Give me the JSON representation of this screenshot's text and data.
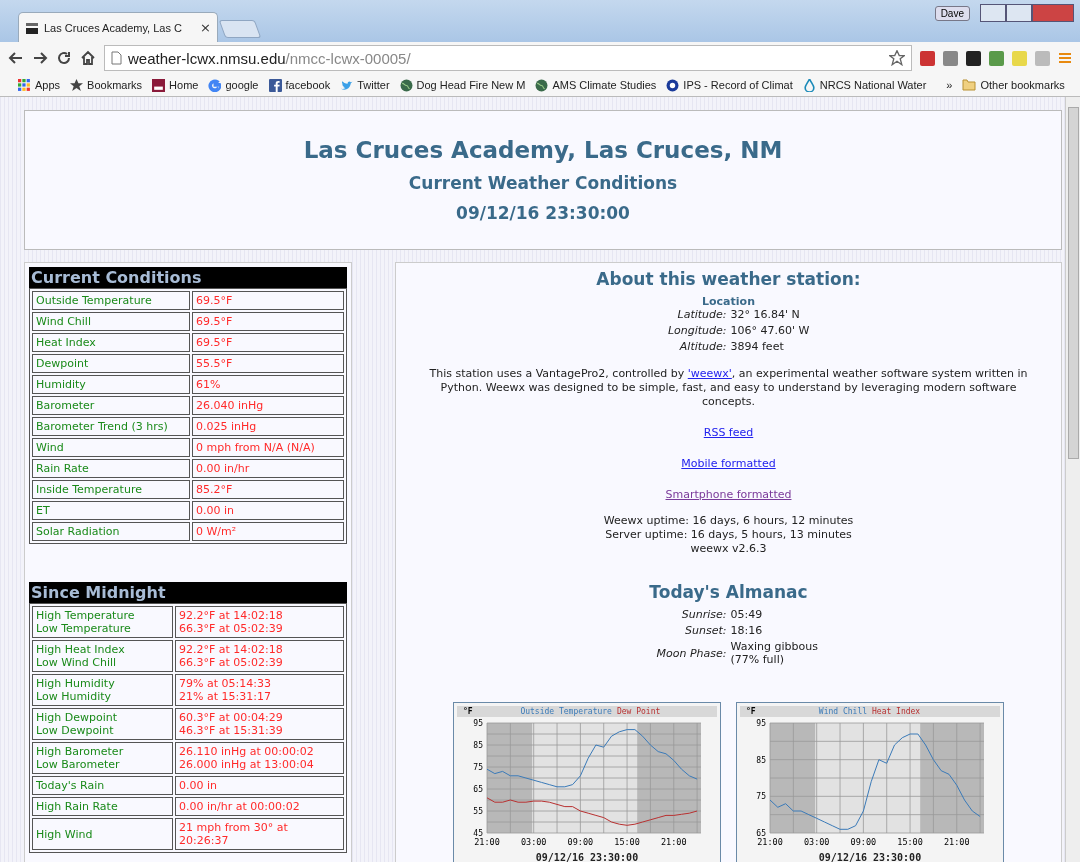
{
  "browser": {
    "tab": {
      "title": "Las Cruces Academy, Las C",
      "close": "×"
    },
    "profile": "Dave",
    "address": {
      "domain": "weather-lcwx.nmsu.edu",
      "path": "/nmcc-lcwx-00005/"
    },
    "bookmarks": [
      {
        "label": "Apps",
        "kind": "apps"
      },
      {
        "label": "Bookmarks",
        "kind": "star"
      },
      {
        "label": "Home",
        "kind": "badge"
      },
      {
        "label": "google",
        "kind": "google"
      },
      {
        "label": "facebook",
        "kind": "facebook"
      },
      {
        "label": "Twitter",
        "kind": "twitter"
      },
      {
        "label": "Dog Head Fire New M",
        "kind": "globe"
      },
      {
        "label": "AMS Climate Studies",
        "kind": "globe"
      },
      {
        "label": "IPS - Record of Climat",
        "kind": "seal"
      },
      {
        "label": "NRCS National Water",
        "kind": "drop"
      }
    ],
    "overflow": "»",
    "other_bookmarks": "Other bookmarks"
  },
  "header": {
    "station": "Las Cruces Academy, Las Cruces, NM",
    "subtitle": "Current Weather Conditions",
    "timestamp": "09/12/16 23:30:00"
  },
  "current_conditions": {
    "title": "Current Conditions",
    "rows": [
      {
        "label": "Outside Temperature",
        "value": "69.5°F"
      },
      {
        "label": "Wind Chill",
        "value": "69.5°F"
      },
      {
        "label": "Heat Index",
        "value": "69.5°F"
      },
      {
        "label": "Dewpoint",
        "value": "55.5°F"
      },
      {
        "label": "Humidity",
        "value": "61%"
      },
      {
        "label": "Barometer",
        "value": "26.040 inHg"
      },
      {
        "label": "Barometer Trend (3 hrs)",
        "value": "0.025 inHg"
      },
      {
        "label": "Wind",
        "value": "0 mph from N/A (N/A)"
      },
      {
        "label": "Rain Rate",
        "value": "0.00 in/hr"
      },
      {
        "label": "Inside Temperature",
        "value": "85.2°F"
      },
      {
        "label": "ET",
        "value": "0.00 in"
      },
      {
        "label": "Solar Radiation",
        "value": "0 W/m²"
      }
    ]
  },
  "since_midnight": {
    "title": "Since Midnight",
    "rows": [
      {
        "labels": [
          "High Temperature",
          "Low Temperature"
        ],
        "values": [
          "92.2°F at 14:02:18",
          "66.3°F at 05:02:39"
        ]
      },
      {
        "labels": [
          "High Heat Index",
          "Low Wind Chill"
        ],
        "values": [
          "92.2°F at 14:02:18",
          "66.3°F at 05:02:39"
        ]
      },
      {
        "labels": [
          "High Humidity",
          "Low Humidity"
        ],
        "values": [
          "79% at 05:14:33",
          "21% at 15:31:17"
        ]
      },
      {
        "labels": [
          "High Dewpoint",
          "Low Dewpoint"
        ],
        "values": [
          "60.3°F at 00:04:29",
          "46.3°F at 15:31:39"
        ]
      },
      {
        "labels": [
          "High Barometer",
          "Low Barometer"
        ],
        "values": [
          "26.110 inHg at 00:00:02",
          "26.000 inHg at 13:00:04"
        ]
      },
      {
        "labels": [
          "Today's Rain"
        ],
        "values": [
          "0.00 in"
        ]
      },
      {
        "labels": [
          "High Rain Rate"
        ],
        "values": [
          "0.00 in/hr at 00:00:02"
        ]
      },
      {
        "labels": [
          "High Wind"
        ],
        "values": [
          "21 mph from 30° at 20:26:37"
        ]
      }
    ]
  },
  "about": {
    "title": "About this weather station:",
    "location_heading": "Location",
    "location": [
      {
        "label": "Latitude:",
        "value": "32° 16.84' N"
      },
      {
        "label": "Longitude:",
        "value": "106° 47.60' W"
      },
      {
        "label": "Altitude:",
        "value": "3894 feet"
      }
    ],
    "description_before": "This station uses a VantagePro2, controlled by ",
    "description_link": "'weewx'",
    "description_after": ", an experimental weather software system written in Python. Weewx was designed to be simple, fast, and easy to understand by leveraging modern software concepts.",
    "links": [
      {
        "label": "RSS feed",
        "visited": false
      },
      {
        "label": "Mobile formatted",
        "visited": false
      },
      {
        "label": "Smartphone formatted",
        "visited": true
      }
    ],
    "uptime": [
      "Weewx uptime: 16 days, 6 hours, 12 minutes",
      "Server uptime: 16 days, 5 hours, 13 minutes",
      "weewx v2.6.3"
    ]
  },
  "almanac": {
    "title": "Today's Almanac",
    "rows": [
      {
        "label": "Sunrise:",
        "value": "05:49"
      },
      {
        "label": "Sunset:",
        "value": "18:16"
      },
      {
        "label": "Moon Phase:",
        "value": "Waxing gibbous\n(77% full)"
      }
    ]
  },
  "charts": [
    {
      "timestamp": "09/12/16 23:30:00",
      "chart_data": {
        "type": "line",
        "grid": true,
        "ylabel": "°F",
        "ylim": [
          45,
          95
        ],
        "yticks": [
          45,
          55,
          65,
          75,
          85,
          95
        ],
        "categories": [
          "21:00",
          null,
          null,
          null,
          null,
          null,
          "03:00",
          null,
          null,
          null,
          null,
          null,
          "09:00",
          null,
          null,
          null,
          null,
          null,
          "15:00",
          null,
          null,
          null,
          null,
          null,
          "21:00",
          null,
          null,
          null
        ],
        "series": [
          {
            "name": "Outside Temperature",
            "color": "#3a7ab8",
            "values": [
              74,
              72,
              73,
              71,
              71,
              70,
              69,
              68,
              67,
              66,
              66,
              67,
              71,
              79,
              85,
              84,
              89,
              91,
              92,
              92,
              89,
              85,
              82,
              81,
              78,
              74,
              71,
              69.5
            ]
          },
          {
            "name": "Dew Point",
            "color": "#b83030",
            "values": [
              61,
              59,
              59,
              60,
              59,
              59,
              59.5,
              59.5,
              59,
              58,
              57,
              57,
              55,
              54,
              53,
              52,
              50,
              49,
              48.5,
              49,
              50,
              51,
              52,
              53,
              53,
              53.5,
              54,
              55
            ]
          }
        ]
      }
    },
    {
      "timestamp": "09/12/16 23:30:00",
      "chart_data": {
        "type": "line",
        "grid": true,
        "ylabel": "°F",
        "ylim": [
          65,
          95
        ],
        "yticks": [
          65,
          75,
          85,
          95
        ],
        "categories": [
          "21:00",
          null,
          null,
          null,
          null,
          null,
          "03:00",
          null,
          null,
          null,
          null,
          null,
          "09:00",
          null,
          null,
          null,
          null,
          null,
          "15:00",
          null,
          null,
          null,
          null,
          null,
          "21:00",
          null,
          null,
          null
        ],
        "series": [
          {
            "name": "Wind Chill",
            "color": "#3a7ab8",
            "values": [
              74,
              72,
              73,
              71,
              71,
              70,
              69,
              68,
              67,
              66,
              66,
              67,
              71,
              79,
              85,
              84,
              89,
              91,
              92,
              92,
              89,
              85,
              82,
              81,
              78,
              74,
              71,
              69.5
            ]
          },
          {
            "name": "Heat Index",
            "color": "#b83030",
            "values": [
              null,
              null,
              null,
              null,
              null,
              null,
              null,
              null,
              null,
              null,
              null,
              null,
              null,
              null,
              null,
              null,
              null,
              null,
              null,
              null,
              null,
              null,
              null,
              null,
              null,
              null,
              null,
              null
            ]
          }
        ]
      }
    }
  ]
}
